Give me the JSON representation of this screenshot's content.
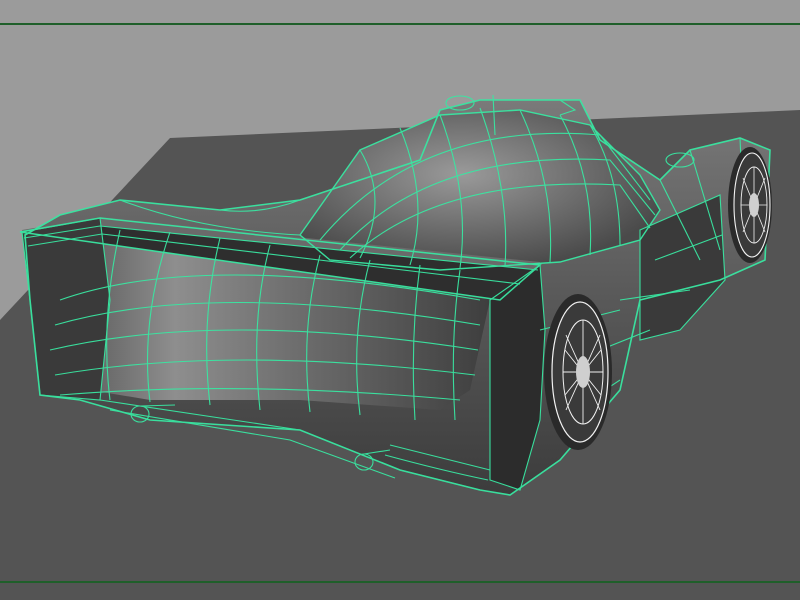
{
  "viewport": {
    "background": "#9b9b9b",
    "floor_color": "#545454",
    "wire_color": "#39e7a2",
    "wheel_wire_color": "#f2f2f2",
    "model_shade": "#5e5e5e"
  },
  "objects": {
    "car": "race-car-wireframe-model",
    "floor": "ground-plane"
  }
}
